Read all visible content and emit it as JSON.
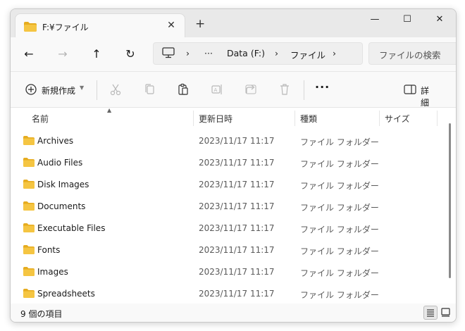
{
  "titlebar": {
    "tab_title": "F:¥ファイル",
    "close_symbol": "✕",
    "new_tab_symbol": "+",
    "minimize_symbol": "—",
    "maximize_symbol": "☐",
    "window_close_symbol": "✕"
  },
  "navbar": {
    "back_symbol": "←",
    "forward_symbol": "→",
    "up_symbol": "↑",
    "refresh_symbol": "↻",
    "breadcrumb": {
      "ellipsis": "···",
      "drive": "Data (F:)",
      "folder": "ファイル",
      "separator": "›"
    },
    "search_placeholder": "ファイルの検索"
  },
  "commandbar": {
    "new_label": "新規作成",
    "more_symbol": "···",
    "details_label": "詳細"
  },
  "columns": {
    "name": "名前",
    "date": "更新日時",
    "type": "種類",
    "size": "サイズ"
  },
  "files": [
    {
      "name": "Archives",
      "date": "2023/11/17 11:17",
      "type": "ファイル フォルダー"
    },
    {
      "name": "Audio Files",
      "date": "2023/11/17 11:17",
      "type": "ファイル フォルダー"
    },
    {
      "name": "Disk Images",
      "date": "2023/11/17 11:17",
      "type": "ファイル フォルダー"
    },
    {
      "name": "Documents",
      "date": "2023/11/17 11:17",
      "type": "ファイル フォルダー"
    },
    {
      "name": "Executable Files",
      "date": "2023/11/17 11:17",
      "type": "ファイル フォルダー"
    },
    {
      "name": "Fonts",
      "date": "2023/11/17 11:17",
      "type": "ファイル フォルダー"
    },
    {
      "name": "Images",
      "date": "2023/11/17 11:17",
      "type": "ファイル フォルダー"
    },
    {
      "name": "Spreadsheets",
      "date": "2023/11/17 11:17",
      "type": "ファイル フォルダー"
    }
  ],
  "status": {
    "item_count": "9 個の項目"
  },
  "colors": {
    "folder": "#f5c542",
    "folder_tab": "#e6ac1f",
    "accent": "#1a73c8"
  }
}
